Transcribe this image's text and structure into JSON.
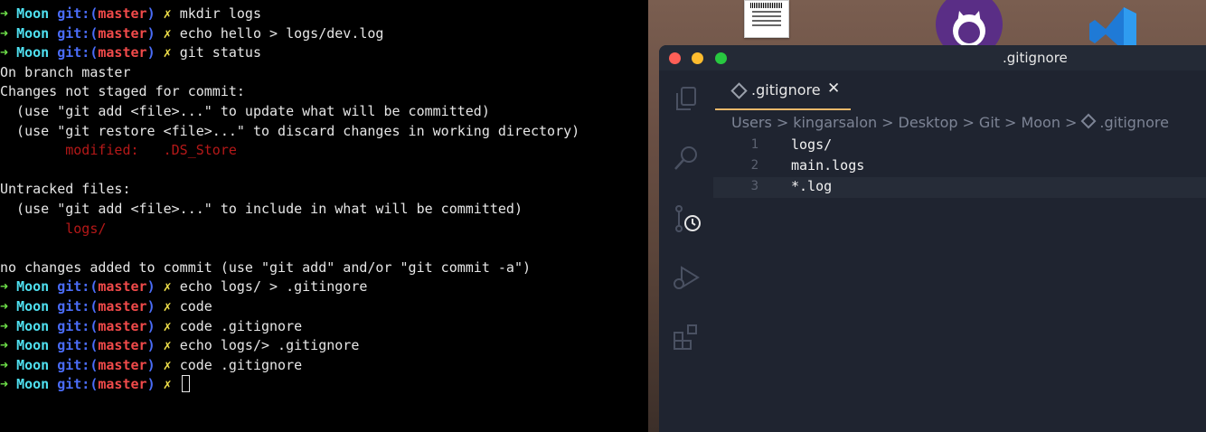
{
  "terminal": {
    "prompt": {
      "arrow": "➜",
      "dir": "Moon",
      "git": "git:(",
      "branch": "master",
      "close": ")",
      "dirty": "✗"
    },
    "lines": [
      {
        "type": "prompt",
        "cmd": "mkdir logs"
      },
      {
        "type": "prompt",
        "cmd": "echo hello > logs/dev.log"
      },
      {
        "type": "prompt",
        "cmd": "git status"
      },
      {
        "type": "output",
        "text": "On branch master"
      },
      {
        "type": "output",
        "text": "Changes not staged for commit:"
      },
      {
        "type": "output",
        "text": "  (use \"git add <file>...\" to update what will be committed)"
      },
      {
        "type": "output",
        "text": "  (use \"git restore <file>...\" to discard changes in working directory)"
      },
      {
        "type": "red",
        "text": "        modified:   .DS_Store"
      },
      {
        "type": "output",
        "text": ""
      },
      {
        "type": "output",
        "text": "Untracked files:"
      },
      {
        "type": "output",
        "text": "  (use \"git add <file>...\" to include in what will be committed)"
      },
      {
        "type": "red",
        "text": "        logs/"
      },
      {
        "type": "output",
        "text": ""
      },
      {
        "type": "output",
        "text": "no changes added to commit (use \"git add\" and/or \"git commit -a\")"
      },
      {
        "type": "prompt",
        "cmd": "echo logs/ > .gitingore"
      },
      {
        "type": "prompt",
        "cmd": "code"
      },
      {
        "type": "prompt",
        "cmd": "code .gitignore"
      },
      {
        "type": "prompt",
        "cmd": "echo logs/> .gitignore"
      },
      {
        "type": "prompt",
        "cmd": "code .gitignore"
      },
      {
        "type": "prompt",
        "cmd": "",
        "cursor": true
      }
    ]
  },
  "vscode": {
    "window_title": ".gitignore",
    "tab": {
      "label": ".gitignore",
      "close": "✕",
      "icon": "diamond-file-icon"
    },
    "breadcrumb": [
      "Users",
      "kingarsalon",
      "Desktop",
      "Git",
      "Moon",
      ".gitignore"
    ],
    "breadcrumb_separator": ">",
    "activity_icons": [
      "explorer-icon",
      "search-icon",
      "source-control-icon",
      "run-debug-icon",
      "extensions-icon"
    ],
    "editor_lines": [
      {
        "num": "1",
        "text": "logs/"
      },
      {
        "num": "2",
        "text": "main.logs"
      },
      {
        "num": "3",
        "text": "*.log"
      }
    ],
    "active_line": 3
  },
  "colors": {
    "prompt_arrow": "#6ee04a",
    "prompt_dir": "#4fe0f0",
    "prompt_git": "#4a6cf7",
    "prompt_branch": "#f04a4a",
    "prompt_dirty": "#f0e04a",
    "git_red": "#b51818",
    "tab_active_border": "#e8b86a",
    "editor_bg": "#1f2430"
  }
}
